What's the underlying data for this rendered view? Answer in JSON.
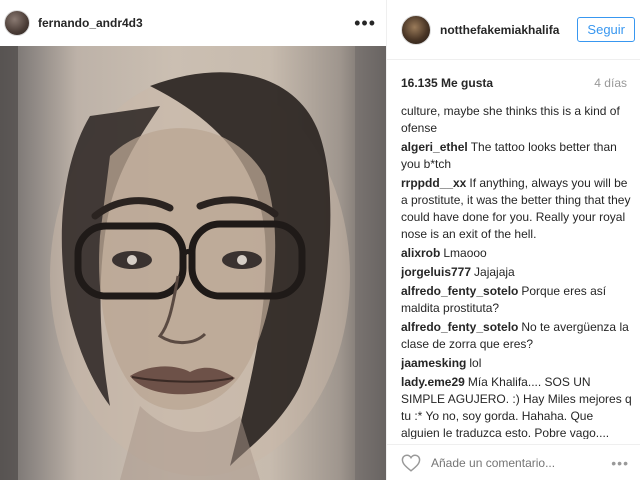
{
  "post": {
    "author": "fernando_andr4d3",
    "more_label": "•••"
  },
  "panel": {
    "user": "notthefakemiakhalifa",
    "follow_label": "Seguir",
    "likes": "16.135 Me gusta",
    "age": "4 días",
    "comments": [
      {
        "user": "",
        "text": "culture, maybe she thinks this is a kind of ofense"
      },
      {
        "user": "algeri_ethel",
        "text": "The tattoo looks better than you b*tch"
      },
      {
        "user": "rrppdd__xx",
        "text": "If anything, always you will be a prostitute, it was the better thing that they could have done for you. Really your royal nose is an exit of the hell."
      },
      {
        "user": "alixrob",
        "text": "Lmaooo"
      },
      {
        "user": "jorgeluis777",
        "text": "Jajajaja"
      },
      {
        "user": "alfredo_fenty_sotelo",
        "text": "Porque eres así maldita prostituta?"
      },
      {
        "user": "alfredo_fenty_sotelo",
        "text": "No te avergüenza la clase de zorra que eres?"
      },
      {
        "user": "jaamesking",
        "text": "lol"
      },
      {
        "user": "lady.eme29",
        "text": "Mía Khalifa.... SOS UN SIMPLE AGUJERO. :) Hay Miles mejores q tu :* Yo no, soy gorda. Hahaha. Que alguien le traduzca esto. Pobre vago...."
      }
    ],
    "comment_placeholder": "Añade un comentario...",
    "options_label": "•••"
  },
  "icons": {
    "like": "heart-icon",
    "options": "more-options-icon"
  },
  "colors": {
    "accent": "#3897f0",
    "text": "#262626",
    "muted": "#999999",
    "border": "#efefef"
  }
}
